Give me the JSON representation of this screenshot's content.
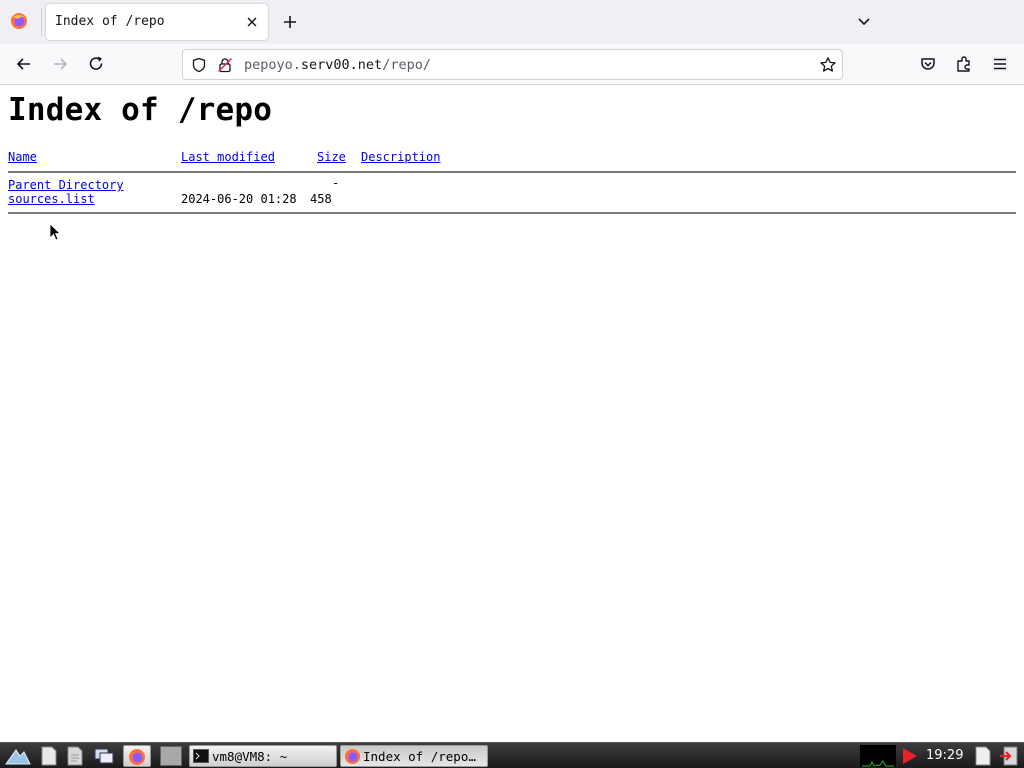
{
  "browser": {
    "tab_title": "Index of /repo",
    "url_prefix": "pepoyo.",
    "url_domain": "serv00.net",
    "url_path": "/repo/"
  },
  "page": {
    "heading": "Index of /repo",
    "columns": {
      "name": "Name",
      "last_modified": "Last modified",
      "size": "Size",
      "description": "Description"
    },
    "rows": [
      {
        "name": "Parent Directory",
        "last_modified": "",
        "size": "-",
        "description": ""
      },
      {
        "name": "sources.list",
        "last_modified": "2024-06-20 01:28",
        "size": "458",
        "description": ""
      }
    ]
  },
  "taskbar": {
    "terminal_task": "vm8@VM8: ~",
    "browser_task": "Index of /repo…",
    "clock": "19:29"
  },
  "icons": {
    "tabstrip": [
      "firefox-icon",
      "tab-close-icon",
      "new-tab-icon",
      "chevron-down-icon"
    ],
    "navbar": [
      "back-arrow-icon",
      "forward-arrow-icon",
      "reload-icon",
      "shield-icon",
      "insecure-lock-icon",
      "bookmark-star-icon",
      "pocket-icon",
      "extensions-icon",
      "hamburger-menu-icon"
    ],
    "taskbar": [
      "start-menu-icon",
      "file-icon",
      "document-icon",
      "window-switch-icon",
      "firefox-icon",
      "terminal-icon",
      "cpu-graph-icon",
      "volume-icon",
      "notes-icon",
      "logout-icon"
    ]
  },
  "colors": {
    "link": "#0000ee",
    "tabstrip_bg": "#f0f0f4",
    "navbar_bg": "#f9f9fb",
    "taskbar_bg": "#2a2a2a"
  }
}
